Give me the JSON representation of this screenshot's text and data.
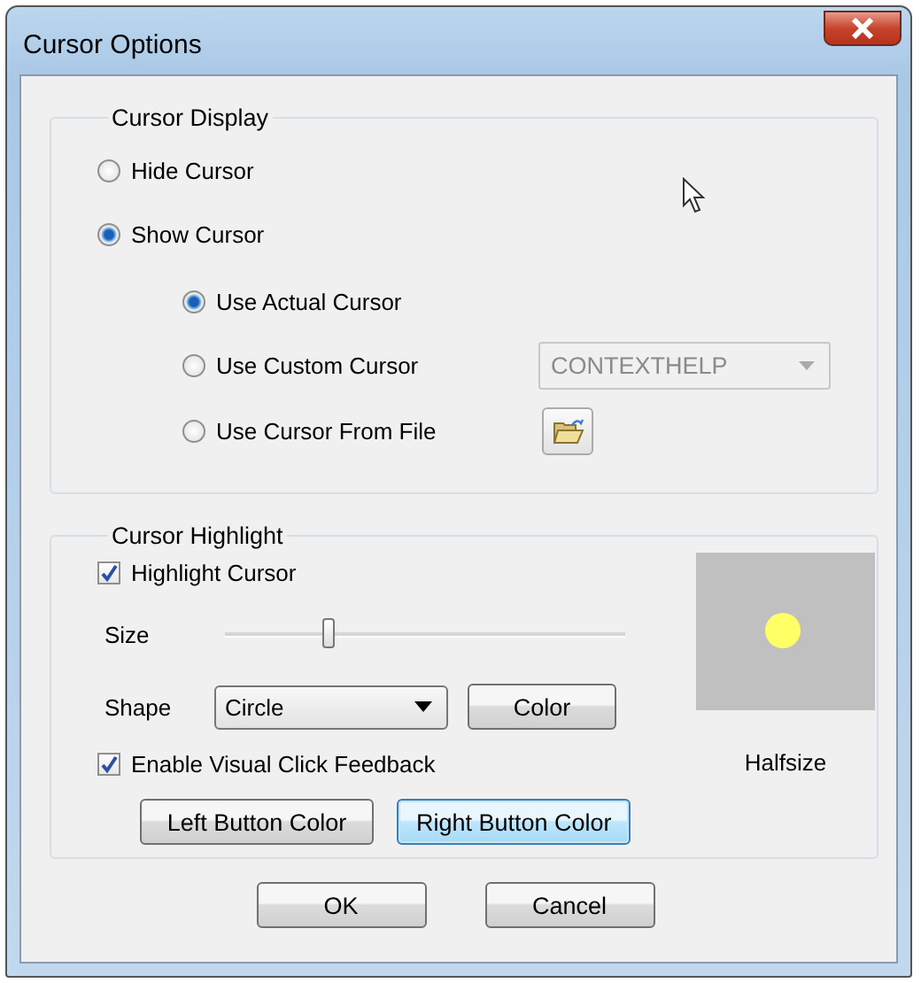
{
  "window": {
    "title": "Cursor Options"
  },
  "cursor_display": {
    "title": "Cursor Display",
    "visibility": [
      {
        "label": "Hide Cursor",
        "selected": false
      },
      {
        "label": "Show Cursor",
        "selected": true
      }
    ],
    "source": [
      {
        "label": "Use Actual Cursor",
        "selected": true,
        "kind": "plain"
      },
      {
        "label": "Use Custom Cursor",
        "selected": false,
        "kind": "dropdown",
        "value": "CONTEXTHELP",
        "disabled": true
      },
      {
        "label": "Use Cursor From File",
        "selected": false,
        "kind": "file"
      }
    ]
  },
  "cursor_highlight": {
    "title": "Cursor Highlight",
    "highlight": {
      "label": "Highlight Cursor",
      "checked": true
    },
    "size": {
      "label": "Size",
      "level": 0.26
    },
    "shape": {
      "label": "Shape",
      "value": "Circle"
    },
    "color_button": "Color",
    "click_feedback": {
      "label": "Enable Visual Click Feedback",
      "checked": true
    },
    "preview_label": "Halfsize",
    "buttons": [
      {
        "label": "Left Button Color",
        "focused": false
      },
      {
        "label": "Right Button Color",
        "focused": true
      }
    ]
  },
  "buttons": [
    "OK",
    "Cancel"
  ]
}
